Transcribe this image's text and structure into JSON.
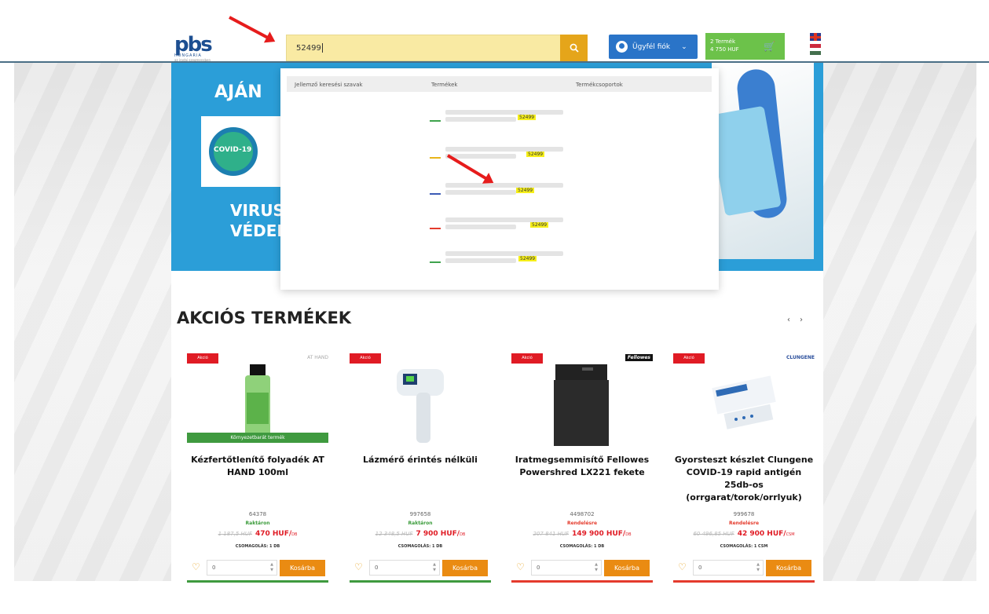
{
  "header": {
    "logo": {
      "mark": "pbs",
      "sub": "HUNGARIA",
      "tag": "az irodai szegmensben"
    },
    "search_value": "52499",
    "account_label": "Ügyfél fiók",
    "cart": {
      "count": "2 Termék",
      "total": "4 750 HUF"
    }
  },
  "hero": {
    "top_text": "AJÁN",
    "covid_label": "COVID-19",
    "bottom_line1": "VIRUS",
    "bottom_line2": "VÉDEK"
  },
  "dropdown": {
    "columns": [
      "Jellemző keresési szavak",
      "Termékek",
      "Termékcsoportok"
    ],
    "results": [
      {
        "match": "52499",
        "color": "#3fa34d"
      },
      {
        "match": "52499",
        "color": "#e8b51b"
      },
      {
        "match": "52499",
        "color": "#3b5bb5"
      },
      {
        "match": "52499",
        "color": "#e43b2d"
      },
      {
        "match": "52499",
        "color": "#3fa34d"
      }
    ]
  },
  "section": {
    "title": "AKCIÓS TERMÉKEK",
    "prev": "‹",
    "next": "›"
  },
  "products": [
    {
      "badge": "Akció",
      "brand": "AT HAND",
      "eco": "Környezetbarát termék",
      "name": "Kézfertőtlenítő folyadék AT HAND 100ml",
      "sku": "64378",
      "stock": "Raktáron",
      "old_price": "1 187,5 HUF",
      "new_price": "470 HUF/",
      "unit": "DB",
      "pack": "CSOMAGOLÁS: 1 DB",
      "qty": "0",
      "buy": "Kosárba"
    },
    {
      "badge": "Akció",
      "brand": "",
      "name": "Lázmérő érintés nélküli",
      "sku": "997658",
      "stock": "Raktáron",
      "old_price": "12 348,5 HUF",
      "new_price": "7 900 HUF/",
      "unit": "DB",
      "pack": "CSOMAGOLÁS: 1 DB",
      "qty": "0",
      "buy": "Kosárba"
    },
    {
      "badge": "Akció",
      "brand": "Fellowes",
      "name": "Iratmegsemmisítő Fellowes Powershred LX221 fekete",
      "sku": "4498702",
      "stock": "Rendelésre",
      "old_price": "207 841 HUF",
      "new_price": "149 900 HUF/",
      "unit": "DB",
      "pack": "CSOMAGOLÁS: 1 DB",
      "qty": "0",
      "buy": "Kosárba"
    },
    {
      "badge": "Akció",
      "brand": "CLUNGENE",
      "name": "Gyorsteszt készlet Clungene COVID-19 rapid antigén 25db-os (orrgarat/torok/orrlyuk)",
      "sku": "999678",
      "stock": "Rendelésre",
      "old_price": "60 496,85 HUF",
      "new_price": "42 900 HUF/",
      "unit": "CSM",
      "pack": "CSOMAGOLÁS: 1 CSM",
      "qty": "0",
      "buy": "Kosárba"
    }
  ]
}
